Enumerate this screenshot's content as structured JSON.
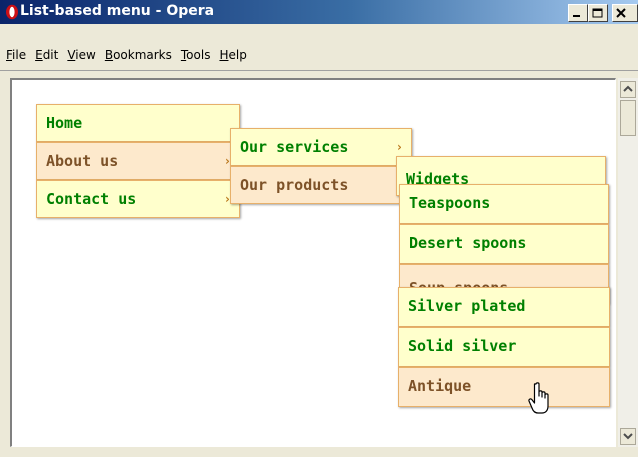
{
  "window": {
    "title": "List-based menu - Opera",
    "controls": {
      "minimize": "minimize",
      "maximize": "maximize",
      "close": "close"
    }
  },
  "menubar": {
    "items": [
      {
        "label": "File",
        "key": "F",
        "rest": "ile"
      },
      {
        "label": "Edit",
        "key": "E",
        "rest": "dit"
      },
      {
        "label": "View",
        "key": "V",
        "rest": "iew"
      },
      {
        "label": "Bookmarks",
        "key": "B",
        "rest": "ookmarks"
      },
      {
        "label": "Tools",
        "key": "T",
        "rest": "ools"
      },
      {
        "label": "Help",
        "key": "H",
        "rest": "elp"
      }
    ]
  },
  "menu": {
    "level1": [
      {
        "label": "Home"
      },
      {
        "label": "About us",
        "arrow": "›"
      },
      {
        "label": "Contact us",
        "arrow": "›"
      }
    ],
    "level2": [
      {
        "label": "Our services",
        "arrow": "›"
      },
      {
        "label": "Our products",
        "arrow": "›"
      }
    ],
    "level3": [
      {
        "label": "Widgets"
      },
      {
        "label": "Teaspoons"
      },
      {
        "label": "Desert spoons"
      },
      {
        "label": "Soup spoons"
      }
    ],
    "level4": [
      {
        "label": "Silver plated"
      },
      {
        "label": "Solid silver"
      },
      {
        "label": "Antique"
      }
    ]
  },
  "colors": {
    "item_bg": "#ffffcc",
    "item_hover_bg": "#fde9cc",
    "item_text": "#008000",
    "border": "#e7b06a"
  },
  "icons": [
    "opera-icon",
    "minimize-icon",
    "maximize-icon",
    "close-icon",
    "hand-cursor-icon"
  ]
}
